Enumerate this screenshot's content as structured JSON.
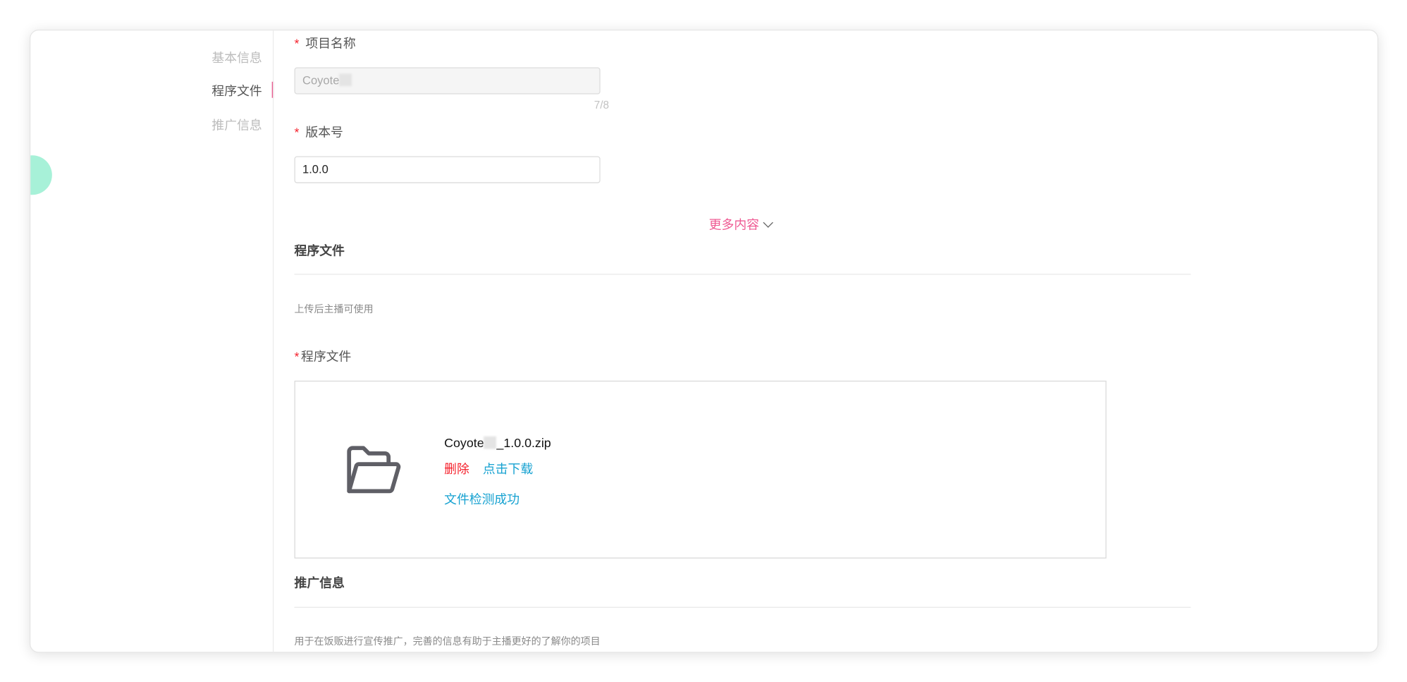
{
  "sidebar": {
    "items": [
      {
        "label": "基本信息",
        "active": false
      },
      {
        "label": "程序文件",
        "active": true
      },
      {
        "label": "推广信息",
        "active": false
      }
    ]
  },
  "form": {
    "project_name": {
      "required_mark": "*",
      "label": "项目名称",
      "value": "Coyote",
      "counter": "7/8",
      "disabled": true
    },
    "version": {
      "required_mark": "*",
      "label": "版本号",
      "value": "1.0.0"
    },
    "more_link": "更多内容"
  },
  "program_file_section": {
    "title": "程序文件",
    "hint": "上传后主播可使用",
    "field_required_mark": "*",
    "field_label": "程序文件",
    "file": {
      "name_prefix": "Coyote",
      "name_suffix": "_1.0.0.zip",
      "delete_label": "删除",
      "download_label": "点击下载",
      "status": "文件检测成功"
    }
  },
  "promo_section": {
    "title": "推广信息",
    "hint": "用于在饭贩进行宣传推广，完善的信息有助于主播更好的了解你的项目"
  },
  "colors": {
    "accent_pink": "#ef5a93",
    "required_red": "#f5222d",
    "link_blue": "#17a2d1",
    "bubble_green": "#a7f1d8"
  },
  "icons": {
    "folder": "folder-open-icon",
    "chevron": "chevron-down-icon"
  }
}
